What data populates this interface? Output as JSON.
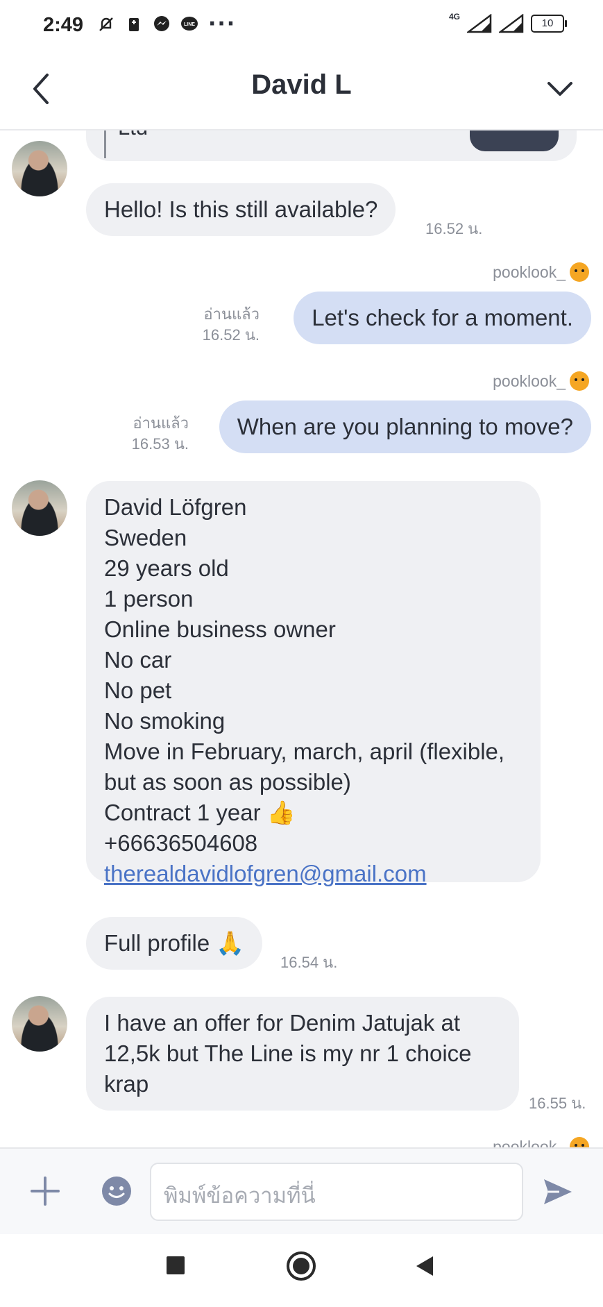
{
  "status_bar": {
    "time": "2:49",
    "network": "4G",
    "battery": "10"
  },
  "header": {
    "title": "David L"
  },
  "messages": {
    "partial_top_text": "Ltd",
    "m1": {
      "text": "Hello! Is this still available?",
      "time": "16.52 น."
    },
    "m2": {
      "sender": "pooklook_",
      "text": "Let's check for a moment.",
      "read": "อ่านแล้ว",
      "time": "16.52 น."
    },
    "m3": {
      "sender": "pooklook_",
      "text": "When are you planning to move?",
      "read": "อ่านแล้ว",
      "time": "16.53 น."
    },
    "m4": {
      "lines": [
        "David Löfgren",
        "Sweden",
        "29 years old",
        "1 person",
        "Online business owner",
        "No car",
        "No pet",
        "No smoking",
        "Move in February, march, april (flexible,",
        "but as soon as possible)",
        "Contract 1 year 👍",
        "+66636504608"
      ],
      "email": "therealdavidlofgren@gmail.com"
    },
    "m5": {
      "text": "Full profile 🙏",
      "time": "16.54 น."
    },
    "m6": {
      "lines": [
        "I have an offer for Denim Jatujak at",
        "12,5k but The Line is my nr 1 choice",
        "krap"
      ],
      "time": "16.55 น."
    },
    "m7_partial_sender": "pooklook_"
  },
  "input": {
    "placeholder": "พิมพ์ข้อความที่นี่"
  },
  "colors": {
    "incoming_bubble": "#eff0f3",
    "outgoing_bubble": "#d4def4",
    "link": "#4a73c6",
    "send_icon": "#7e89a7"
  }
}
